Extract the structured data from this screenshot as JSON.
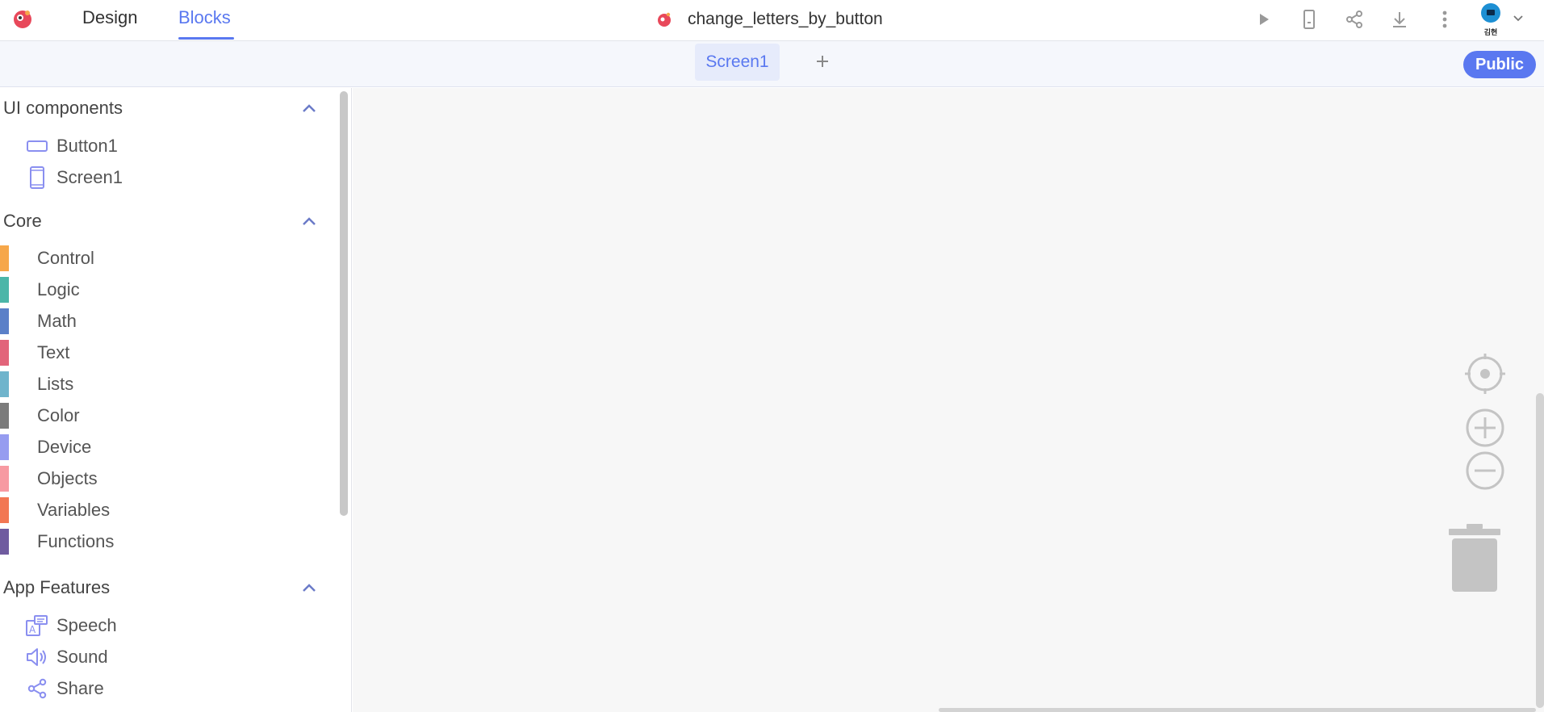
{
  "header": {
    "nav": {
      "design": "Design",
      "blocks": "Blocks"
    },
    "project_name": "change_letters_by_button",
    "avatar_label": "김현",
    "icons": [
      "run-icon",
      "device-icon",
      "share-icon",
      "download-icon",
      "more-icon"
    ]
  },
  "subbar": {
    "screen_tab": "Screen1",
    "add_label": "+",
    "public_label": "Public"
  },
  "sidebar": {
    "ui_components": {
      "title": "UI components",
      "items": [
        {
          "label": "Button1",
          "icon": "button-icon"
        },
        {
          "label": "Screen1",
          "icon": "phone-icon"
        }
      ]
    },
    "core": {
      "title": "Core",
      "items": [
        {
          "label": "Control",
          "color": "#f6a74a"
        },
        {
          "label": "Logic",
          "color": "#4bb6a8"
        },
        {
          "label": "Math",
          "color": "#5b80c8"
        },
        {
          "label": "Text",
          "color": "#e2647a"
        },
        {
          "label": "Lists",
          "color": "#6fb4cc"
        },
        {
          "label": "Color",
          "color": "#7b7b7b"
        },
        {
          "label": "Device",
          "color": "#969cf0"
        },
        {
          "label": "Objects",
          "color": "#f79aa2"
        },
        {
          "label": "Variables",
          "color": "#f27753"
        },
        {
          "label": "Functions",
          "color": "#6f5b9f"
        }
      ]
    },
    "app_features": {
      "title": "App Features",
      "items": [
        {
          "label": "Speech",
          "icon": "speech-icon"
        },
        {
          "label": "Sound",
          "icon": "speaker-icon"
        },
        {
          "label": "Share",
          "icon": "share-icon"
        }
      ]
    }
  },
  "colors": {
    "accent": "#5a78f0",
    "workspace_bg": "#f7f7f7"
  }
}
